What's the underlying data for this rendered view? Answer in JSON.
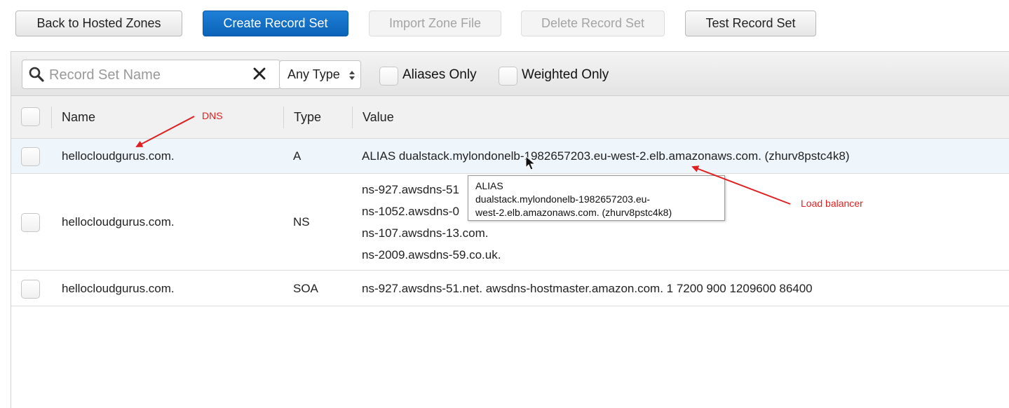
{
  "toolbar": {
    "back_label": "Back to Hosted Zones",
    "create_label": "Create Record Set",
    "import_label": "Import Zone File",
    "delete_label": "Delete Record Set",
    "test_label": "Test Record Set"
  },
  "filters": {
    "search_placeholder": "Record Set Name",
    "type_value": "Any Type",
    "aliases_only_label": "Aliases Only",
    "weighted_only_label": "Weighted Only"
  },
  "table": {
    "headers": {
      "name": "Name",
      "type": "Type",
      "value": "Value"
    },
    "rows": [
      {
        "name": "hellocloudgurus.com.",
        "type": "A",
        "values": [
          "ALIAS dualstack.mylondonelb-1982657203.eu-west-2.elb.amazonaws.com. (zhurv8pstc4k8)"
        ]
      },
      {
        "name": "hellocloudgurus.com.",
        "type": "NS",
        "values": [
          "ns-927.awsdns-51",
          "ns-1052.awsdns-0",
          "ns-107.awsdns-13.com.",
          "ns-2009.awsdns-59.co.uk."
        ]
      },
      {
        "name": "hellocloudgurus.com.",
        "type": "SOA",
        "values": [
          "ns-927.awsdns-51.net. awsdns-hostmaster.amazon.com. 1 7200 900 1209600 86400"
        ]
      }
    ]
  },
  "tooltip": {
    "lines": [
      "ALIAS",
      "dualstack.mylondonelb-1982657203.eu-",
      "west-2.elb.amazonaws.com. (zhurv8pstc4k8)"
    ]
  },
  "annotations": {
    "dns": "DNS",
    "load_balancer": "Load balancer"
  },
  "colors": {
    "primary": "#0a63b8",
    "annotation": "#e02020",
    "selected_row": "#eef6fc"
  },
  "icons": {
    "search": "search-icon",
    "clear": "close-icon",
    "select": "sort-arrows-icon",
    "cursor": "mouse-pointer-icon"
  }
}
